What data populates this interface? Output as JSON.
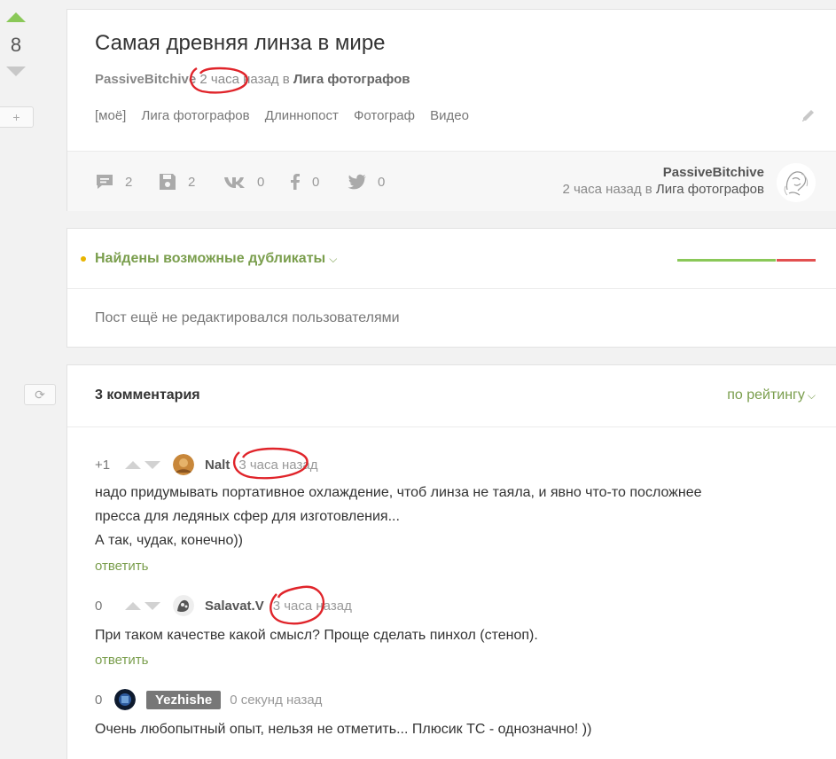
{
  "rail": {
    "rating": "8",
    "plus_label": "+",
    "refresh_label": "⟳"
  },
  "story": {
    "title": "Самая древняя линза в мире",
    "author": "PassiveBitchive",
    "time": "2 часа",
    "time_suffix": "назад в",
    "community": "Лига фотографов",
    "tags": [
      "[моё]",
      "Лига фотографов",
      "Длиннопост",
      "Фотограф",
      "Видео"
    ],
    "stats": {
      "comments": "2",
      "saves": "2",
      "vk": "0",
      "facebook": "0",
      "twitter": "0"
    },
    "footer_author": "PassiveBitchive",
    "footer_time": "2 часа назад в",
    "footer_community": "Лига фотографов"
  },
  "duplicates": {
    "title": "Найдены возможные дубликаты",
    "note": "Пост ещё не редактировался пользователями",
    "bar_green_share": 0.71,
    "colors": {
      "green": "#8ac858",
      "red": "#e25050",
      "dot": "#e8b400"
    }
  },
  "comments_section": {
    "title": "3 комментария",
    "sort_label": "по рейтингу",
    "reply_label": "ответить",
    "items": [
      {
        "rating": "+1",
        "author": "Nalt",
        "time": "3 часа назад",
        "lines": [
          "надо придумывать портативное охлаждение, чтоб линза не таяла, и явно что-то посложнее",
          "пресса для ледяных сфер для изготовления...",
          "А так, чудак, конечно))"
        ]
      },
      {
        "rating": "0",
        "author": "Salavat.V",
        "time": "3 часа назад",
        "lines": [
          "При таком качестве какой смысл? Проще сделать пинхол (стеноп)."
        ]
      },
      {
        "rating": "0",
        "author": "Yezhishe",
        "time": "0 секунд назад",
        "lines": [
          "Очень любопытный опыт, нельзя не отметить... Плюсик ТС - однозначно! ))"
        ]
      }
    ]
  },
  "accent_color": "#7a9e4d",
  "annotation_color": "#e0242a"
}
